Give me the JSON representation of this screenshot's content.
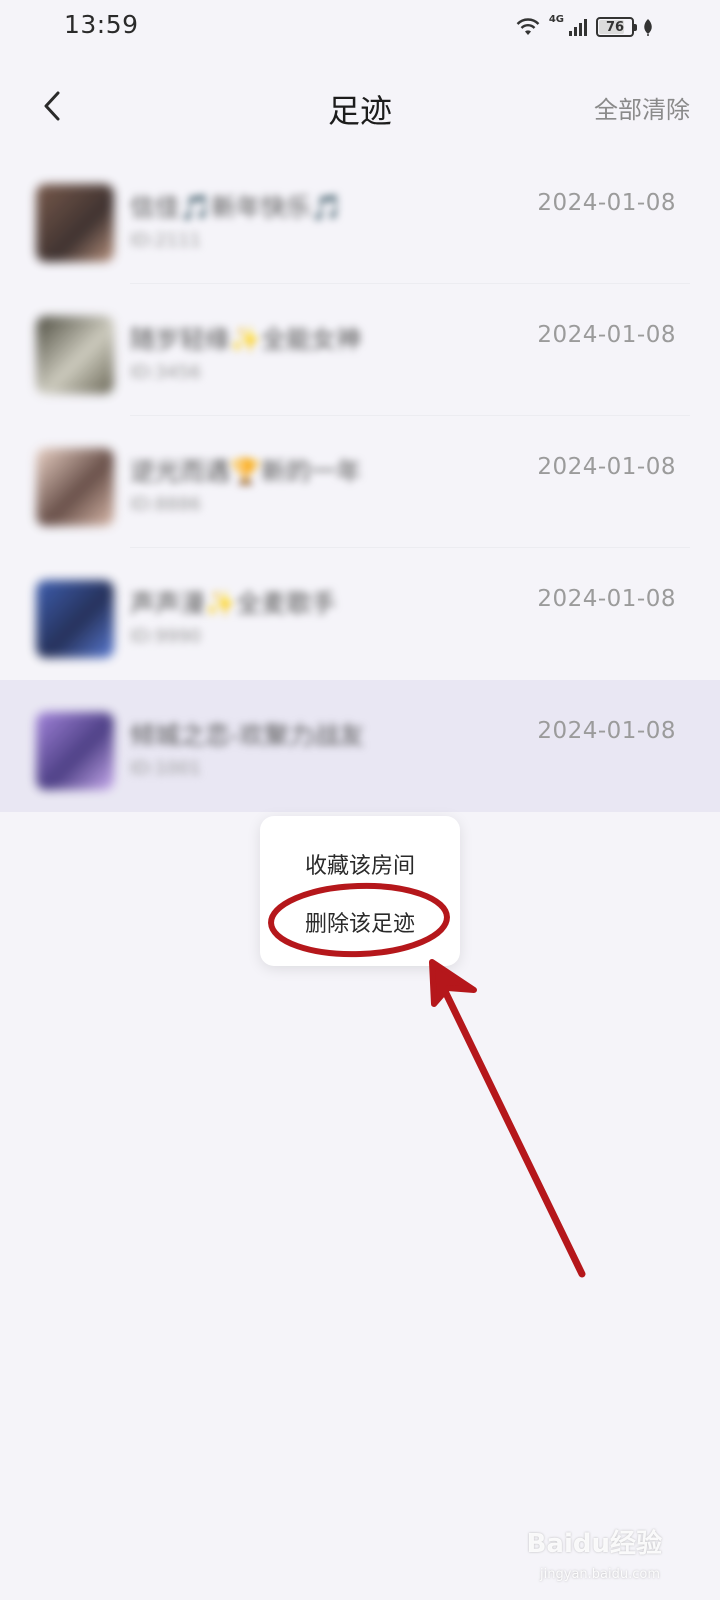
{
  "status_bar": {
    "time": "13:59",
    "network": "4G",
    "battery": "76"
  },
  "header": {
    "title": "足迹",
    "clear_all": "全部清除",
    "back_icon": "chevron-left-icon"
  },
  "history": [
    {
      "name": "信佳🎵新年快乐🎵",
      "id": "ID:2111",
      "date": "2024-01-08"
    },
    {
      "name": "随岁轻缘✨全能女神",
      "id": "ID:3456",
      "date": "2024-01-08"
    },
    {
      "name": "逆光而遇🏆新的一年",
      "id": "ID:8886",
      "date": "2024-01-08"
    },
    {
      "name": "声声漫✨全麦歌手",
      "id": "ID:9990",
      "date": "2024-01-08"
    },
    {
      "name": "倾城之恋-欢聚力战友",
      "id": "ID:1001",
      "date": "2024-01-08"
    }
  ],
  "popup": {
    "favorite": "收藏该房间",
    "delete": "删除该足迹"
  },
  "colors": {
    "annotation": "#b5171b",
    "background": "#f5f4f9",
    "highlight": "#e9e7f3"
  },
  "watermark": {
    "text": "Baidu经验",
    "url": "jingyan.baidu.com"
  }
}
